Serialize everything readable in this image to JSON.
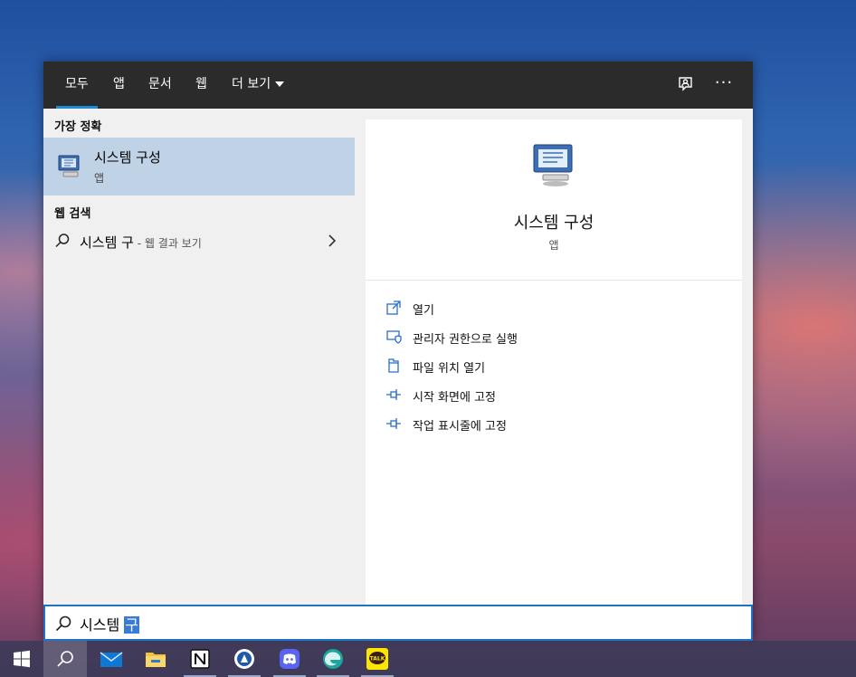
{
  "tabs": [
    {
      "label": "모두"
    },
    {
      "label": "앱"
    },
    {
      "label": "문서"
    },
    {
      "label": "웹"
    },
    {
      "label": "더 보기"
    }
  ],
  "top_icons": [
    "feedback-icon",
    "more-options-icon"
  ],
  "more_options_glyph": "···",
  "best_match": {
    "section_title": "가장 정확",
    "name": "시스템 구성",
    "kind": "앱",
    "icon": "system-config-icon"
  },
  "web_search": {
    "section_title": "웹 검색",
    "query": "시스템 구",
    "suffix": " - 웹 결과 보기"
  },
  "detail": {
    "name": "시스템 구성",
    "kind": "앱",
    "actions": [
      {
        "label": "열기",
        "icon": "open-icon"
      },
      {
        "label": "관리자 권한으로 실행",
        "icon": "run-as-admin-icon"
      },
      {
        "label": "파일 위치 열기",
        "icon": "file-location-icon"
      },
      {
        "label": "시작 화면에 고정",
        "icon": "pin-icon"
      },
      {
        "label": "작업 표시줄에 고정",
        "icon": "pin-icon"
      }
    ]
  },
  "search": {
    "typed": "시스템 ",
    "selected": "구"
  },
  "taskbar": {
    "items": [
      "windows-start-icon",
      "search-icon",
      "mail-icon",
      "file-explorer-icon",
      "notion-icon",
      "app-blue-icon",
      "discord-icon",
      "edge-icon",
      "kakaotalk-icon"
    ],
    "kakaotalk_label": "TALK"
  },
  "colors": {
    "accent": "#1e8ad6",
    "selected_row": "#c0d2e6",
    "topbar": "#2b2b2b"
  }
}
